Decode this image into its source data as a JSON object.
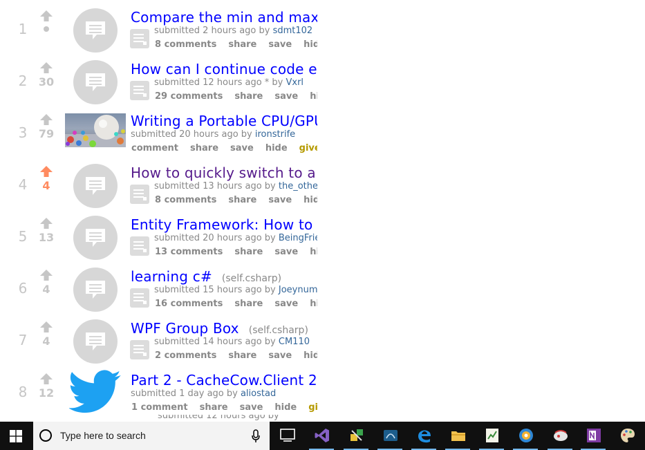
{
  "posts": [
    {
      "rank": "1",
      "score": "",
      "title": "Compare the min and max",
      "domain": "",
      "submitted": "submitted 2 hours ago by",
      "author": "sdmt102",
      "comments": "8 comments",
      "share": "share",
      "save": "save",
      "hide": "hide",
      "gold": "",
      "thumb": "self",
      "visited": false,
      "upvoted": false
    },
    {
      "rank": "2",
      "score": "30",
      "title": "How can I continue code ex",
      "domain": "",
      "submitted": "submitted 12 hours ago * by",
      "author": "Vxrl",
      "comments": "29 comments",
      "share": "share",
      "save": "save",
      "hide": "hide",
      "gold": "",
      "thumb": "self",
      "visited": false,
      "upvoted": false
    },
    {
      "rank": "3",
      "score": "79",
      "title": "Writing a Portable CPU/GPU",
      "domain": "",
      "submitted": "submitted 20 hours ago by",
      "author": "ironstrife",
      "comments": "comment",
      "share": "share",
      "save": "save",
      "hide": "hide",
      "gold": "give go",
      "thumb": "image",
      "visited": false,
      "upvoted": false
    },
    {
      "rank": "4",
      "score": "4",
      "title": "How to quickly switch to a",
      "domain": "",
      "submitted": "submitted 13 hours ago by",
      "author": "the_other",
      "comments": "8 comments",
      "share": "share",
      "save": "save",
      "hide": "hide",
      "gold": "",
      "thumb": "self",
      "visited": true,
      "upvoted": true
    },
    {
      "rank": "5",
      "score": "13",
      "title": "Entity Framework: How to",
      "domain": "",
      "submitted": "submitted 20 hours ago by",
      "author": "BeingFrie",
      "comments": "13 comments",
      "share": "share",
      "save": "save",
      "hide": "hide",
      "gold": "",
      "thumb": "self",
      "visited": false,
      "upvoted": false
    },
    {
      "rank": "6",
      "score": "4",
      "title": "learning c#",
      "domain": "(self.csharp)",
      "submitted": "submitted 15 hours ago by",
      "author": "Joeynum",
      "comments": "16 comments",
      "share": "share",
      "save": "save",
      "hide": "hide",
      "gold": "",
      "thumb": "self",
      "visited": false,
      "upvoted": false
    },
    {
      "rank": "7",
      "score": "4",
      "title": "WPF Group Box",
      "domain": "(self.csharp)",
      "submitted": "submitted 14 hours ago by",
      "author": "CM110",
      "comments": "2 comments",
      "share": "share",
      "save": "save",
      "hide": "hide",
      "gold": "",
      "thumb": "self",
      "visited": false,
      "upvoted": false
    },
    {
      "rank": "8",
      "score": "12",
      "title": "Part 2 - CacheCow.Client 2",
      "domain": "",
      "submitted": "submitted 1 day ago by",
      "author": "aliostad",
      "comments": "1 comment",
      "share": "share",
      "save": "save",
      "hide": "hide",
      "gold": "give g",
      "thumb": "twitter",
      "visited": false,
      "upvoted": false
    }
  ],
  "partial_row_text": "submitted 12 hours ago by",
  "taskbar": {
    "search_placeholder": "Type here to search",
    "apps": [
      "task-view",
      "visual-studio",
      "tools",
      "sql-tool",
      "edge",
      "file-explorer",
      "project-app",
      "browser-app",
      "paint-app",
      "onenote",
      "paint-palette"
    ]
  },
  "colors": {
    "link": "#0000ff",
    "visited_link": "#551a8b",
    "upvote": "#ff8b60",
    "author": "#336699",
    "gold": "#b59a00",
    "muted": "#888888",
    "taskbar": "#101010"
  }
}
